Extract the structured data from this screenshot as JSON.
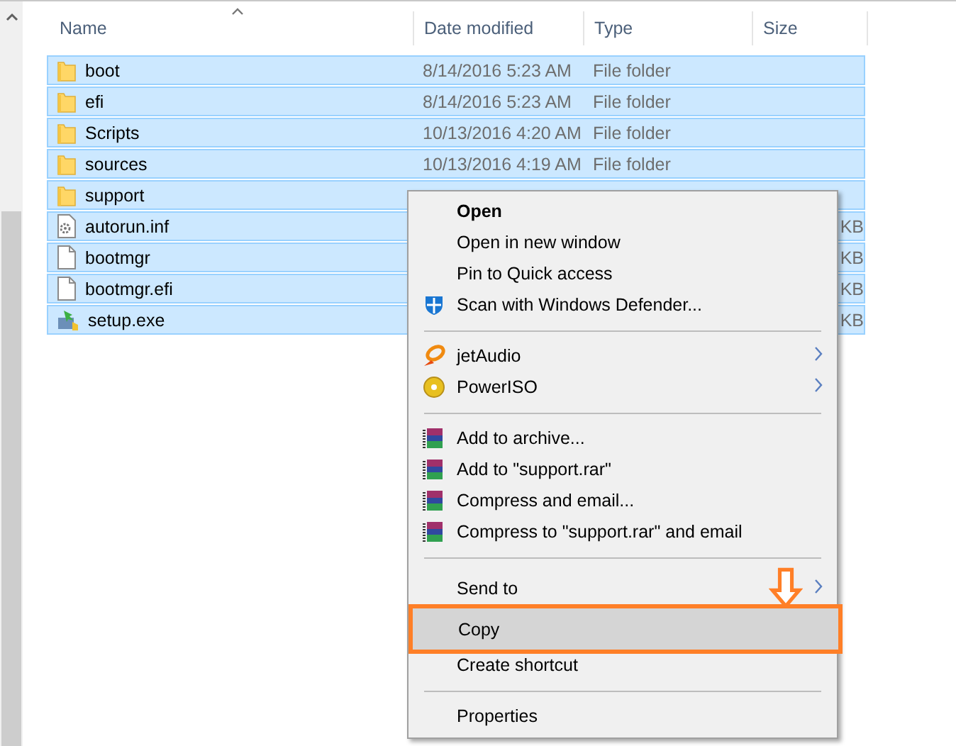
{
  "columns": [
    {
      "label": "Name",
      "sorted": true
    },
    {
      "label": "Date modified",
      "sorted": false
    },
    {
      "label": "Type",
      "sorted": false
    },
    {
      "label": "Size",
      "sorted": false
    }
  ],
  "rows": [
    {
      "name": "boot",
      "kind": "folder",
      "date": "8/14/2016 5:23 AM",
      "type": "File folder",
      "selected": true
    },
    {
      "name": "efi",
      "kind": "folder",
      "date": "8/14/2016 5:23 AM",
      "type": "File folder",
      "selected": true
    },
    {
      "name": "Scripts",
      "kind": "folder",
      "date": "10/13/2016 4:20 AM",
      "type": "File folder",
      "selected": true
    },
    {
      "name": "sources",
      "kind": "folder",
      "date": "10/13/2016 4:19 AM",
      "type": "File folder",
      "selected": true
    },
    {
      "name": "support",
      "kind": "folder",
      "selected": true
    },
    {
      "name": "autorun.inf",
      "kind": "settings",
      "size": "KB",
      "selected": true
    },
    {
      "name": "bootmgr",
      "kind": "file",
      "size": "KB",
      "selected": true
    },
    {
      "name": "bootmgr.efi",
      "kind": "file",
      "size": "KB",
      "selected": true
    },
    {
      "name": "setup.exe",
      "kind": "setup",
      "size": "KB",
      "selected": true
    }
  ],
  "context_menu": [
    {
      "kind": "plain",
      "label": "Open",
      "bold": true
    },
    {
      "kind": "plain",
      "label": "Open in new window",
      "bold": false
    },
    {
      "kind": "plain",
      "label": "Pin to Quick access",
      "bold": false
    },
    {
      "kind": "shield",
      "label": "Scan with Windows Defender...",
      "bold": false
    },
    {
      "kind": "separator"
    },
    {
      "kind": "jetaudio",
      "label": "jetAudio",
      "submenu": true
    },
    {
      "kind": "disc",
      "label": "PowerISO",
      "submenu": true
    },
    {
      "kind": "separator"
    },
    {
      "kind": "archive",
      "label": "Add to archive..."
    },
    {
      "kind": "archive",
      "label": "Add to \"support.rar\""
    },
    {
      "kind": "archive",
      "label": "Compress and email..."
    },
    {
      "kind": "archive",
      "label": "Compress to \"support.rar\" and email"
    },
    {
      "kind": "separator"
    },
    {
      "kind": "plain",
      "label": "Send to",
      "submenu": true,
      "arrow_above": true
    },
    {
      "kind": "plain",
      "label": "Copy",
      "selected": true,
      "outlined": true
    },
    {
      "kind": "plain",
      "label": "Create shortcut"
    },
    {
      "kind": "separator"
    },
    {
      "kind": "plain",
      "label": "Properties"
    }
  ]
}
